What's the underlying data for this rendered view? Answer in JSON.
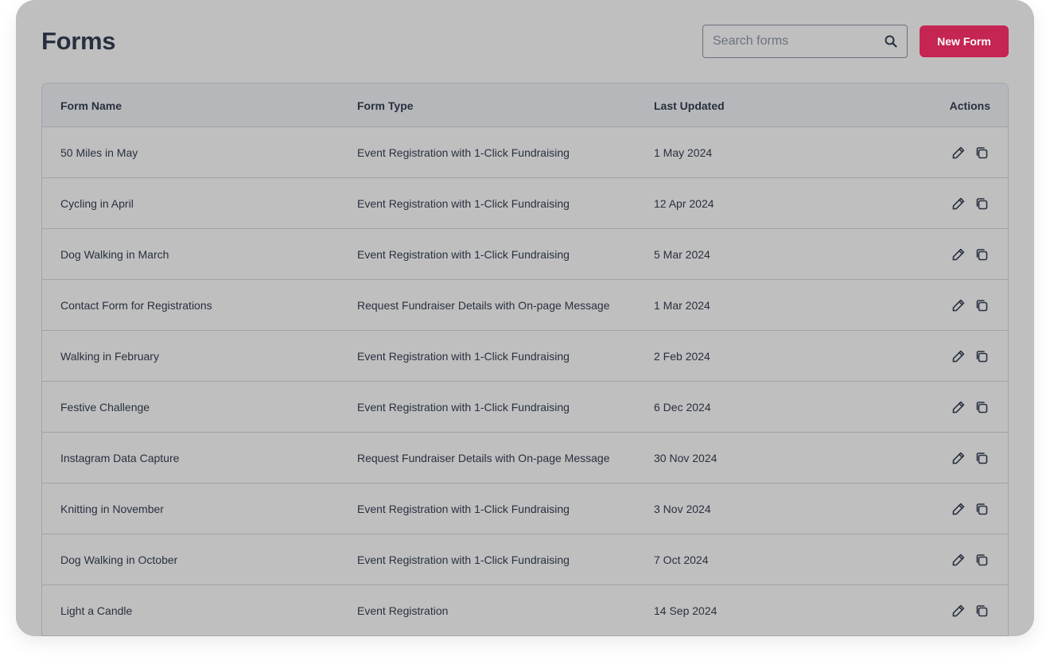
{
  "header": {
    "title": "Forms",
    "search_placeholder": "Search forms",
    "new_button_label": "New Form"
  },
  "table": {
    "columns": {
      "name": "Form Name",
      "type": "Form Type",
      "updated": "Last Updated",
      "actions": "Actions"
    },
    "rows": [
      {
        "name": "50 Miles in May",
        "type": "Event Registration with 1-Click Fundraising",
        "updated": "1 May 2024"
      },
      {
        "name": "Cycling in April",
        "type": "Event Registration with 1-Click Fundraising",
        "updated": "12 Apr 2024"
      },
      {
        "name": "Dog Walking in March",
        "type": "Event Registration with 1-Click Fundraising",
        "updated": "5 Mar 2024"
      },
      {
        "name": "Contact Form for Registrations",
        "type": "Request Fundraiser Details with On-page Message",
        "updated": "1 Mar 2024"
      },
      {
        "name": "Walking in February",
        "type": "Event Registration with 1-Click Fundraising",
        "updated": "2 Feb 2024"
      },
      {
        "name": "Festive Challenge",
        "type": "Event Registration with 1-Click Fundraising",
        "updated": "6 Dec 2024"
      },
      {
        "name": "Instagram Data Capture",
        "type": "Request Fundraiser Details with On-page Message",
        "updated": "30 Nov 2024"
      },
      {
        "name": "Knitting in November",
        "type": "Event Registration with 1-Click Fundraising",
        "updated": "3 Nov 2024"
      },
      {
        "name": "Dog Walking in October",
        "type": "Event Registration with 1-Click Fundraising",
        "updated": "7 Oct 2024"
      },
      {
        "name": "Light a Candle",
        "type": "Event Registration",
        "updated": "14 Sep 2024"
      }
    ]
  },
  "icons": {
    "search": "search-icon",
    "edit": "pencil-icon",
    "duplicate": "copy-icon"
  },
  "colors": {
    "accent": "#c52552",
    "text": "#28303f",
    "background": "#bfbfbf"
  }
}
